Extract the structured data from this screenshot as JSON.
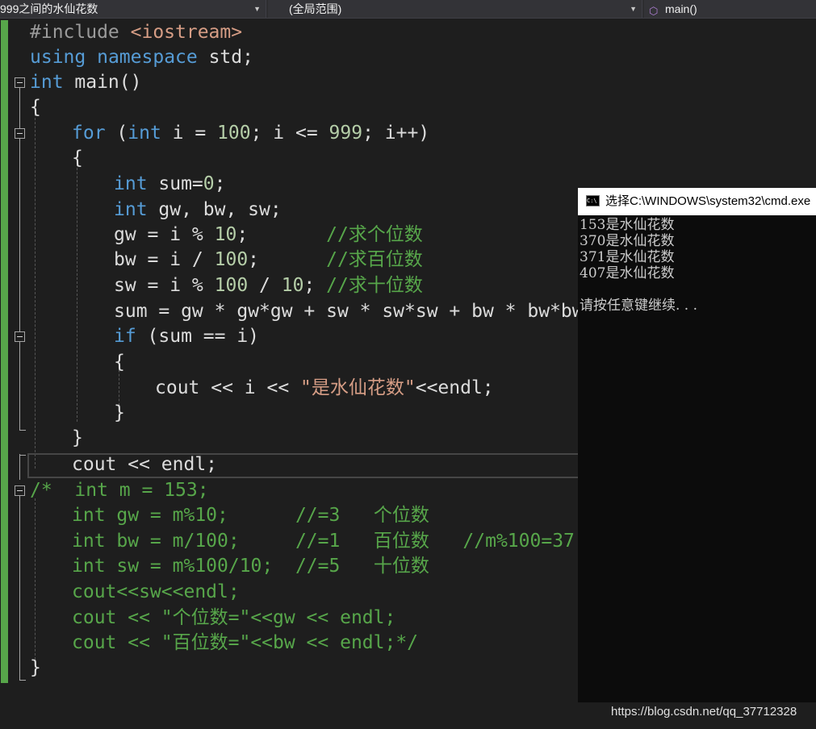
{
  "navbar": {
    "file_dropdown": "999之间的水仙花数",
    "scope_dropdown": "(全局范围)",
    "function_dropdown": "main()",
    "function_icon": "cube-icon"
  },
  "code": {
    "l1_pre": "#include ",
    "l1_inc": "<iostream>",
    "l2_kw1": "using",
    "l2_kw2": "namespace",
    "l2_rest": " std;",
    "l3_kw": "int",
    "l3_rest": " main()",
    "l4": "{",
    "l5_kw": "for",
    "l5_a": " (",
    "l5_kw2": "int",
    "l5_b": " i = ",
    "l5_n1": "100",
    "l5_c": "; i <= ",
    "l5_n2": "999",
    "l5_d": "; i++)",
    "l6": "{",
    "l7_kw": "int",
    "l7_a": " sum=",
    "l7_n": "0",
    "l7_b": ";",
    "l8_kw": "int",
    "l8_rest": " gw, bw, sw;",
    "l9_a": "gw = i % ",
    "l9_n": "10",
    "l9_b": ";       ",
    "l9_cm": "//求个位数",
    "l10_a": "bw = i / ",
    "l10_n": "100",
    "l10_b": ";      ",
    "l10_cm": "//求百位数",
    "l11_a": "sw = i % ",
    "l11_n1": "100",
    "l11_b": " / ",
    "l11_n2": "10",
    "l11_c": "; ",
    "l11_cm": "//求十位数",
    "l12": "sum = gw * gw*gw + sw * sw*sw + bw * bw*bw;",
    "l13_kw": "if",
    "l13_rest": " (sum == i)",
    "l14": "{",
    "l15_a": "cout << i << ",
    "l15_str": "\"是水仙花数\"",
    "l15_b": "<<endl;",
    "l16": "}",
    "l17": "}",
    "l18": "cout << endl;",
    "l19": "/*  int m = 153;",
    "l20": "int gw = m%10;      //=3   个位数",
    "l21": "int bw = m/100;     //=1   百位数   //m%100=37",
    "l22": "int sw = m%100/10;  //=5   十位数",
    "l23": "cout<<sw<<endl;",
    "l24": "cout << \"个位数=\"<<gw << endl;",
    "l25": "cout << \"百位数=\"<<bw << endl;*/",
    "l26": "}"
  },
  "console": {
    "title": "选择C:\\WINDOWS\\system32\\cmd.exe",
    "icon_label": "C:\\",
    "lines": [
      "153是水仙花数",
      "370是水仙花数",
      "371是水仙花数",
      "407是水仙花数",
      "",
      "请按任意键继续. . ."
    ]
  },
  "watermark": "https://blog.csdn.net/qq_37712328"
}
